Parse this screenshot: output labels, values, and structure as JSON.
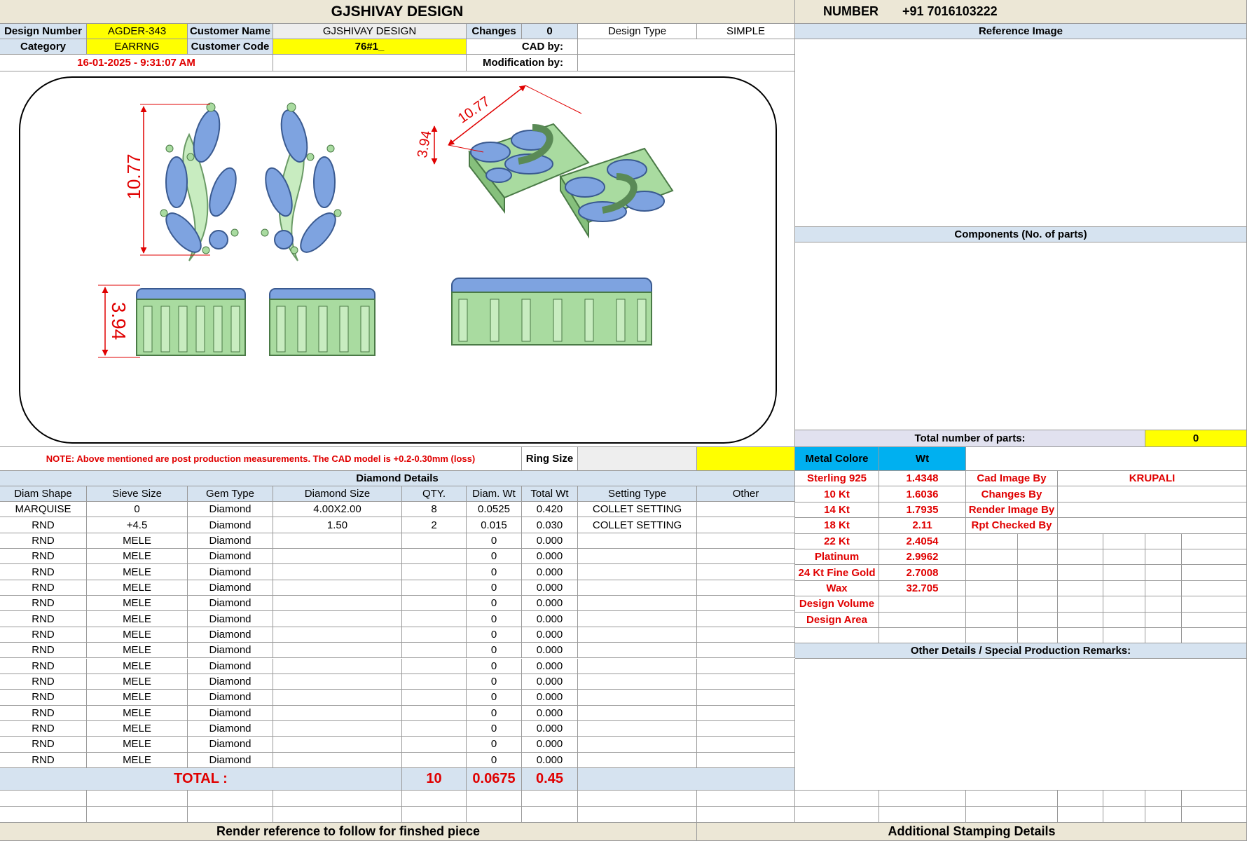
{
  "header": {
    "title": "GJSHIVAY DESIGN",
    "number_label": "NUMBER",
    "number_value": "+91 7016103222"
  },
  "info": {
    "design_number_label": "Design Number",
    "design_number": "AGDER-343",
    "customer_name_label": "Customer Name",
    "customer_name": "GJSHIVAY DESIGN",
    "changes_label": "Changes",
    "changes": "0",
    "design_type_label": "Design Type",
    "design_type": "SIMPLE",
    "category_label": "Category",
    "category": "EARRNG",
    "customer_code_label": "Customer Code",
    "customer_code": "76#1_",
    "cad_by_label": "CAD by:",
    "cad_by": "",
    "datetime": "16-01-2025 - 9:31:07 AM",
    "modification_by_label": "Modification by:",
    "modification_by": ""
  },
  "drawing": {
    "dim_height": "10.77",
    "dim_side": "3.94",
    "dim_iso_length": "10.77",
    "dim_iso_height": "3.94"
  },
  "note": {
    "text": "NOTE: Above mentioned are post production measurements. The CAD model is +0.2-0.30mm (loss)",
    "ring_size_label": "Ring Size",
    "ring_size": ""
  },
  "diamonds": {
    "title": "Diamond Details",
    "columns": [
      "Diam Shape",
      "Sieve Size",
      "Gem Type",
      "Diamond Size",
      "QTY.",
      "Diam. Wt",
      "Total Wt",
      "Setting Type",
      "Other"
    ],
    "rows": [
      [
        "MARQUISE",
        "0",
        "Diamond",
        "4.00X2.00",
        "8",
        "0.0525",
        "0.420",
        "COLLET SETTING",
        ""
      ],
      [
        "RND",
        "+4.5",
        "Diamond",
        "1.50",
        "2",
        "0.015",
        "0.030",
        "COLLET SETTING",
        ""
      ],
      [
        "RND",
        "MELE",
        "Diamond",
        "",
        "",
        "0",
        "0.000",
        "",
        ""
      ],
      [
        "RND",
        "MELE",
        "Diamond",
        "",
        "",
        "0",
        "0.000",
        "",
        ""
      ],
      [
        "RND",
        "MELE",
        "Diamond",
        "",
        "",
        "0",
        "0.000",
        "",
        ""
      ],
      [
        "RND",
        "MELE",
        "Diamond",
        "",
        "",
        "0",
        "0.000",
        "",
        ""
      ],
      [
        "RND",
        "MELE",
        "Diamond",
        "",
        "",
        "0",
        "0.000",
        "",
        ""
      ],
      [
        "RND",
        "MELE",
        "Diamond",
        "",
        "",
        "0",
        "0.000",
        "",
        ""
      ],
      [
        "RND",
        "MELE",
        "Diamond",
        "",
        "",
        "0",
        "0.000",
        "",
        ""
      ],
      [
        "RND",
        "MELE",
        "Diamond",
        "",
        "",
        "0",
        "0.000",
        "",
        ""
      ],
      [
        "RND",
        "MELE",
        "Diamond",
        "",
        "",
        "0",
        "0.000",
        "",
        ""
      ],
      [
        "RND",
        "MELE",
        "Diamond",
        "",
        "",
        "0",
        "0.000",
        "",
        ""
      ],
      [
        "RND",
        "MELE",
        "Diamond",
        "",
        "",
        "0",
        "0.000",
        "",
        ""
      ],
      [
        "RND",
        "MELE",
        "Diamond",
        "",
        "",
        "0",
        "0.000",
        "",
        ""
      ],
      [
        "RND",
        "MELE",
        "Diamond",
        "",
        "",
        "0",
        "0.000",
        "",
        ""
      ],
      [
        "RND",
        "MELE",
        "Diamond",
        "",
        "",
        "0",
        "0.000",
        "",
        ""
      ],
      [
        "RND",
        "MELE",
        "Diamond",
        "",
        "",
        "0",
        "0.000",
        "",
        ""
      ]
    ],
    "total_label": "TOTAL :",
    "total_qty": "10",
    "total_diam_wt": "0.0675",
    "total_wt": "0.45"
  },
  "right": {
    "reference_image_title": "Reference Image",
    "components_title": "Components (No. of parts)",
    "total_parts_label": "Total number of parts:",
    "total_parts": "0",
    "metal_colore_label": "Metal Colore",
    "wt_label": "Wt",
    "metals": [
      {
        "name": "Sterling 925",
        "wt": "1.4348"
      },
      {
        "name": "10 Kt",
        "wt": "1.6036"
      },
      {
        "name": "14 Kt",
        "wt": "1.7935"
      },
      {
        "name": "18 Kt",
        "wt": "2.11"
      },
      {
        "name": "22 Kt",
        "wt": "2.4054"
      },
      {
        "name": "Platinum",
        "wt": "2.9962"
      },
      {
        "name": "24 Kt Fine Gold",
        "wt": "2.7008"
      },
      {
        "name": "Wax",
        "wt": "32.705"
      },
      {
        "name": "Design Volume",
        "wt": ""
      },
      {
        "name": "Design Area",
        "wt": ""
      }
    ],
    "credits": [
      {
        "label": "Cad Image By",
        "value": "KRUPALI"
      },
      {
        "label": "Changes By",
        "value": ""
      },
      {
        "label": "Render Image By",
        "value": ""
      },
      {
        "label": "Rpt Checked By",
        "value": ""
      }
    ],
    "remarks_title": "Other Details / Special Production Remarks:"
  },
  "footer": {
    "render_reference": "Render reference to follow for finshed piece",
    "stamping": "Additional Stamping Details"
  },
  "colors": {
    "tan": "#ece7d6",
    "blue_header": "#d6e3f0",
    "yellow": "#ffff00",
    "metal_header": "#00b0f0",
    "red_text": "#e00000",
    "gem_blue": "#7ea3e0",
    "metal_green": "#a9dba0"
  }
}
